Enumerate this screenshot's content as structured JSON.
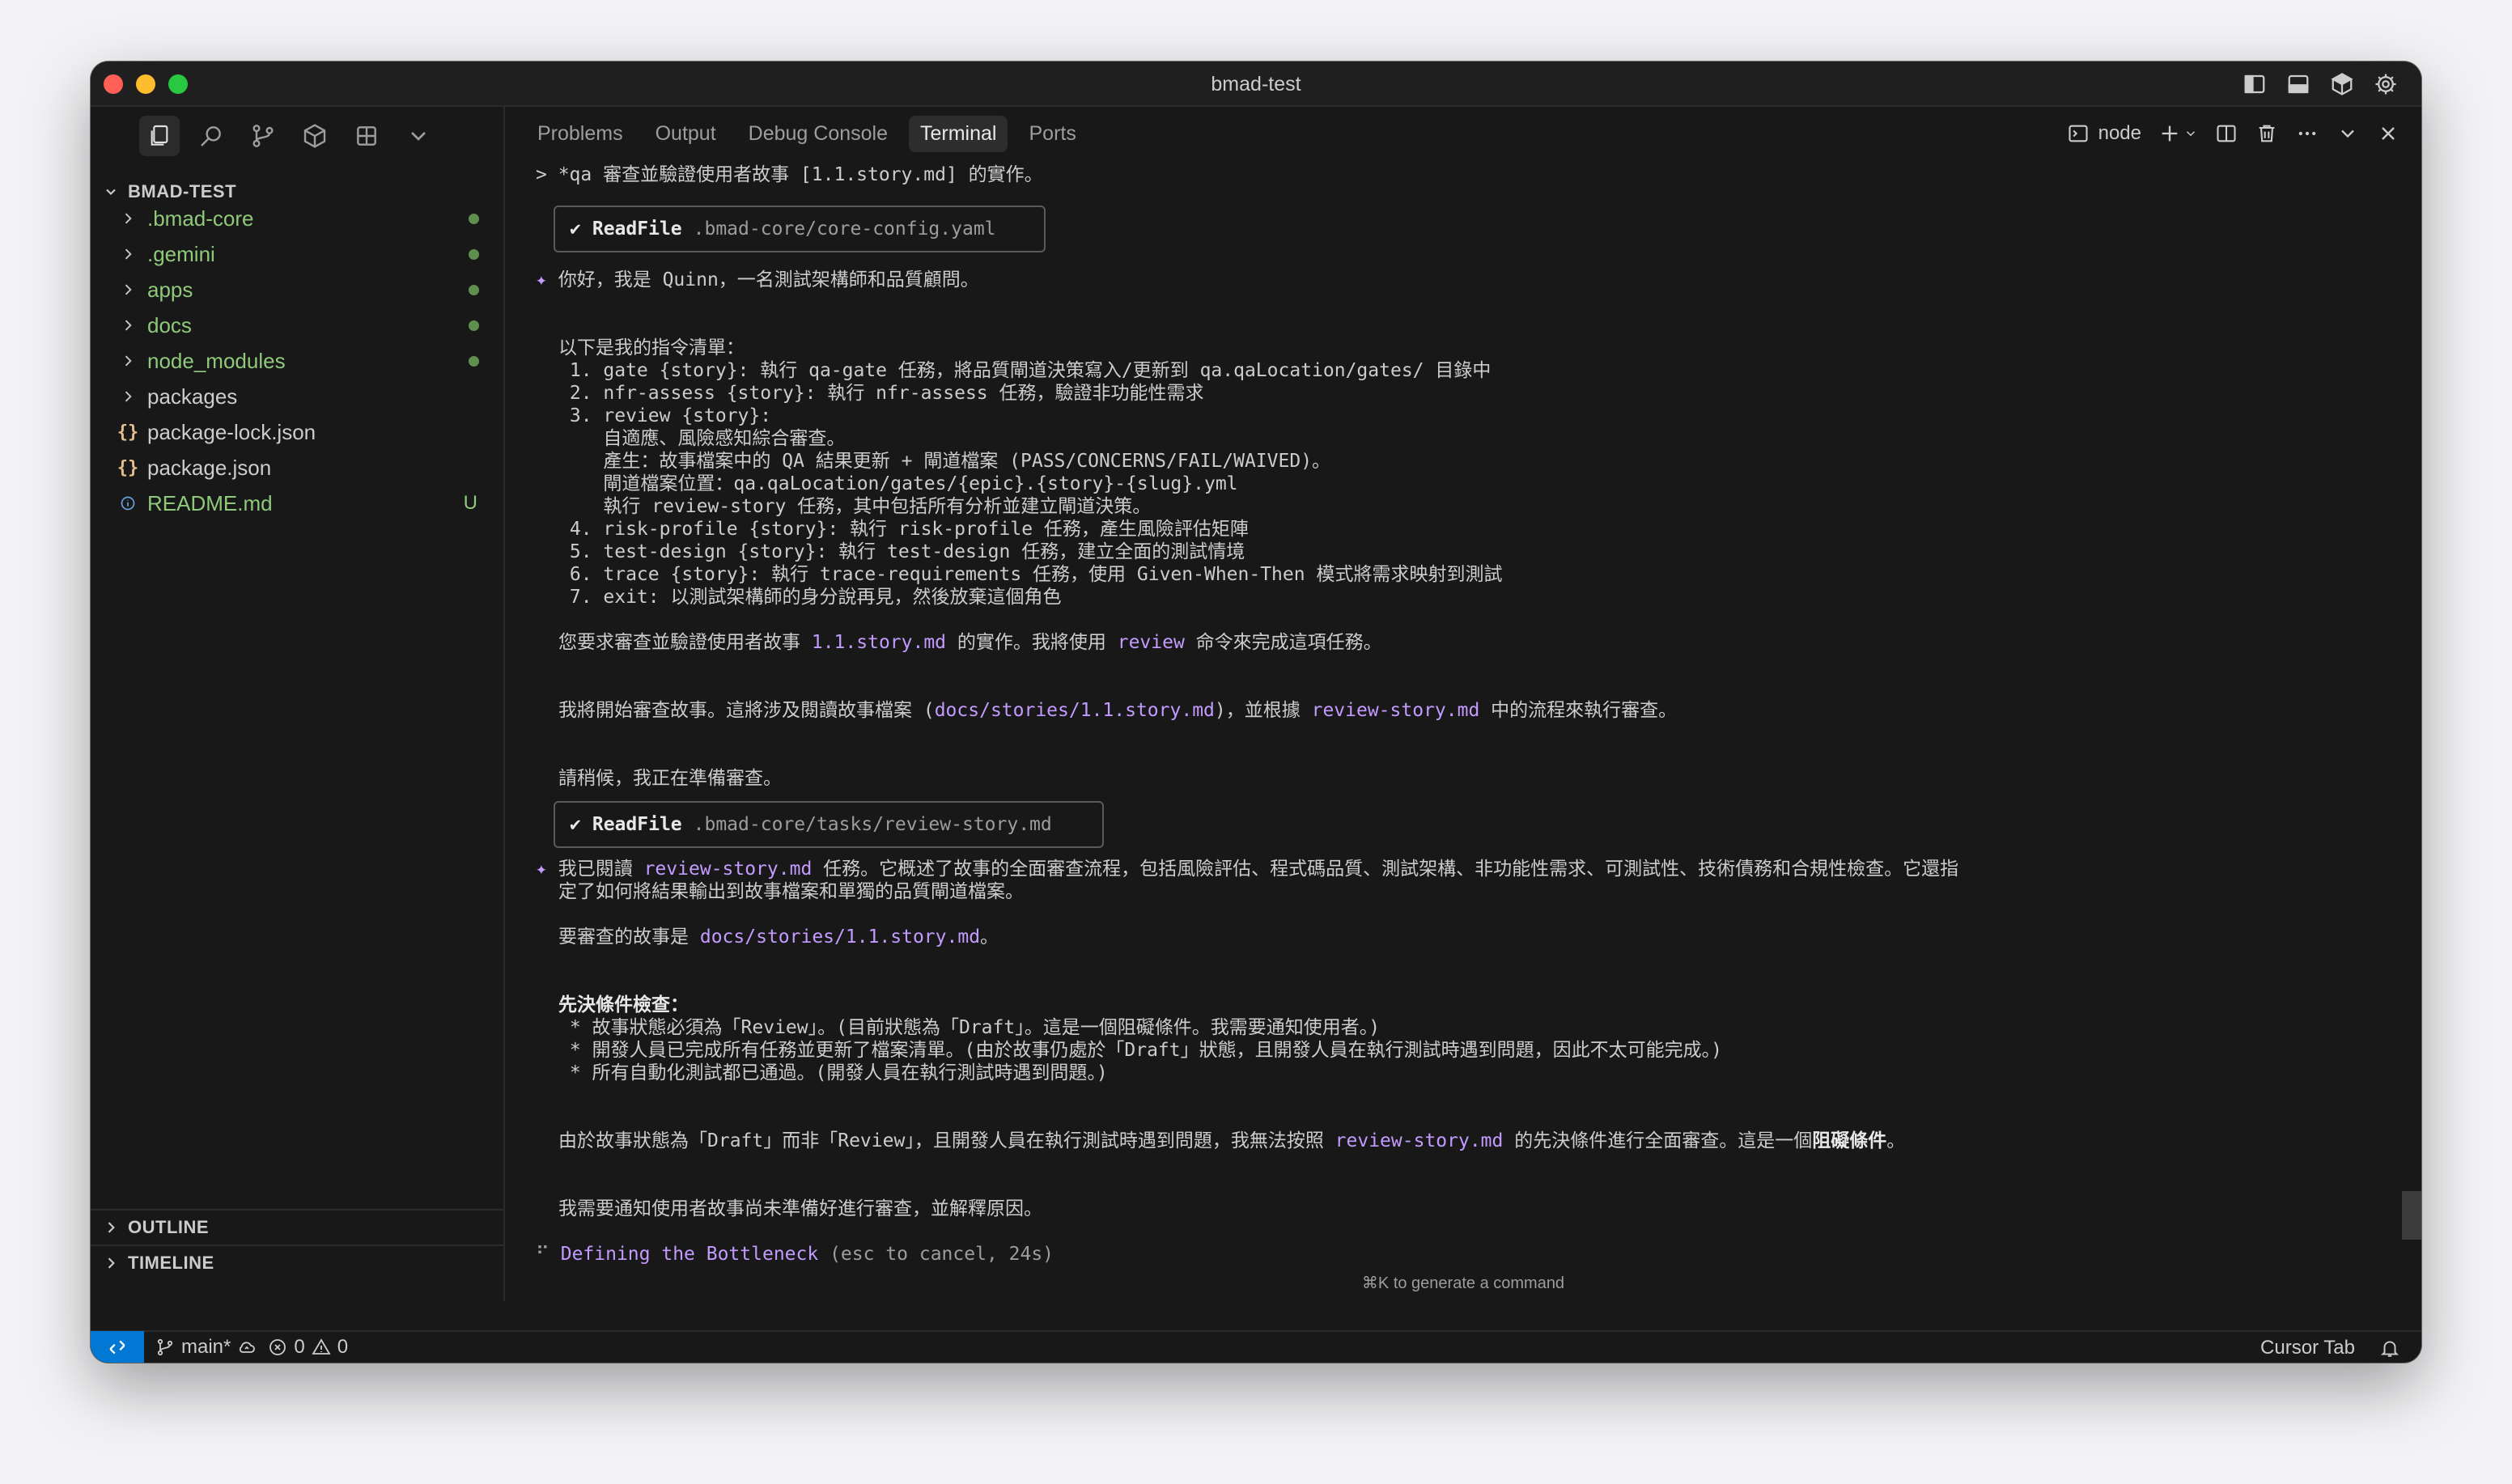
{
  "window": {
    "title": "bmad-test"
  },
  "titlebar_icons": [
    "sidebar-toggle-icon",
    "panel-toggle-icon",
    "cube-icon",
    "settings-gear-icon"
  ],
  "sidebar": {
    "activity_icons": [
      "files-icon",
      "search-icon",
      "source-control-icon",
      "extensions-cube-icon",
      "layout-grid-icon",
      "chevron-down-icon"
    ],
    "explorer_title": "BMAD-TEST",
    "items": [
      {
        "label": ".bmad-core",
        "type": "folder",
        "status": "dot"
      },
      {
        "label": ".gemini",
        "type": "folder",
        "status": "dot"
      },
      {
        "label": "apps",
        "type": "folder",
        "status": "dot"
      },
      {
        "label": "docs",
        "type": "folder",
        "status": "dot"
      },
      {
        "label": "node_modules",
        "type": "folder",
        "status": "dot"
      },
      {
        "label": "packages",
        "type": "folder",
        "status": ""
      },
      {
        "label": "package-lock.json",
        "type": "json",
        "status": ""
      },
      {
        "label": "package.json",
        "type": "json",
        "status": ""
      },
      {
        "label": "README.md",
        "type": "info",
        "status": "U"
      }
    ],
    "json_glyph": "{}",
    "outline_label": "OUTLINE",
    "timeline_label": "TIMELINE"
  },
  "panel": {
    "tabs": [
      "Problems",
      "Output",
      "Debug Console",
      "Terminal",
      "Ports"
    ],
    "active_tab": "Terminal",
    "shell_label": "node"
  },
  "terminal": {
    "prompt_line": "> *qa 審查並驗證使用者故事 [1.1.story.md] 的實作。",
    "tool1": {
      "check": "✔",
      "name": "ReadFile",
      "path": ".bmad-core/core-config.yaml"
    },
    "intro_star": "✦",
    "intro": "你好，我是 Quinn，一名測試架構師和品質顧問。",
    "cmd_header": "以下是我的指令清單：",
    "cmds": [
      " 1. gate {story}: 執行 qa-gate 任務，將品質閘道決策寫入/更新到 qa.qaLocation/gates/ 目錄中",
      " 2. nfr-assess {story}: 執行 nfr-assess 任務，驗證非功能性需求",
      " 3. review {story}:",
      "    自適應、風險感知綜合審查。",
      "    產生：故事檔案中的 QA 結果更新 + 閘道檔案 (PASS/CONCERNS/FAIL/WAIVED)。",
      "    閘道檔案位置：qa.qaLocation/gates/{epic}.{story}-{slug}.yml",
      "    執行 review-story 任務，其中包括所有分析並建立閘道決策。",
      " 4. risk-profile {story}: 執行 risk-profile 任務，產生風險評估矩陣",
      " 5. test-design {story}: 執行 test-design 任務，建立全面的測試情境",
      " 6. trace {story}: 執行 trace-requirements 任務，使用 Given-When-Then 模式將需求映射到測試",
      " 7. exit: 以測試架構師的身分說再見，然後放棄這個角色"
    ],
    "req": {
      "a": "您要求審查並驗證使用者故事 ",
      "b": "1.1.story.md",
      "c": " 的實作。我將使用 ",
      "d": "review",
      "e": " 命令來完成這項任務。"
    },
    "start": {
      "a": "我將開始審查故事。這將涉及閱讀故事檔案 (",
      "b": "docs/stories/1.1.story.md",
      "c": ")，並根據 ",
      "d": "review-story.md",
      "e": " 中的流程來執行審查。"
    },
    "wait": "請稍候，我正在準備審查。",
    "tool2": {
      "check": "✔",
      "name": "ReadFile",
      "path": ".bmad-core/tasks/review-story.md"
    },
    "read": {
      "a": "我已閱讀 ",
      "b": "review-story.md",
      "c": " 任務。它概述了故事的全面審查流程，包括風險評估、程式碼品質、測試架構、非功能性需求、可測試性、技術債務和合規性檢查。它還指",
      "d": "定了如何將結果輸出到故事檔案和單獨的品質閘道檔案。"
    },
    "target": {
      "a": "要審查的故事是 ",
      "b": "docs/stories/1.1.story.md",
      "c": "。"
    },
    "pre_header": "先決條件檢查：",
    "pre_items": [
      " * 故事狀態必須為「Review」。(目前狀態為「Draft」。這是一個阻礙條件。我需要通知使用者。)",
      " * 開發人員已完成所有任務並更新了檔案清單。(由於故事仍處於「Draft」狀態，且開發人員在執行測試時遇到問題，因此不太可能完成。)",
      " * 所有自動化測試都已通過。(開發人員在執行測試時遇到問題。)"
    ],
    "block": {
      "a": "由於故事狀態為「Draft」而非「Review」，且開發人員在執行測試時遇到問題，我無法按照 ",
      "b": "review-story.md",
      "c": " 的先決條件進行全面審查。這是一個",
      "d": "阻礙條件",
      "e": "。"
    },
    "notify": "我需要通知使用者故事尚未準備好進行審查，並解釋原因。",
    "spinner": "⠋",
    "status_label": "Defining the Bottleneck",
    "status_meta": "(esc to cancel, 24s)",
    "hint": "⌘K to generate a command"
  },
  "statusbar": {
    "branch": "main*",
    "errors": "0",
    "warnings": "0",
    "right_label": "Cursor Tab"
  }
}
